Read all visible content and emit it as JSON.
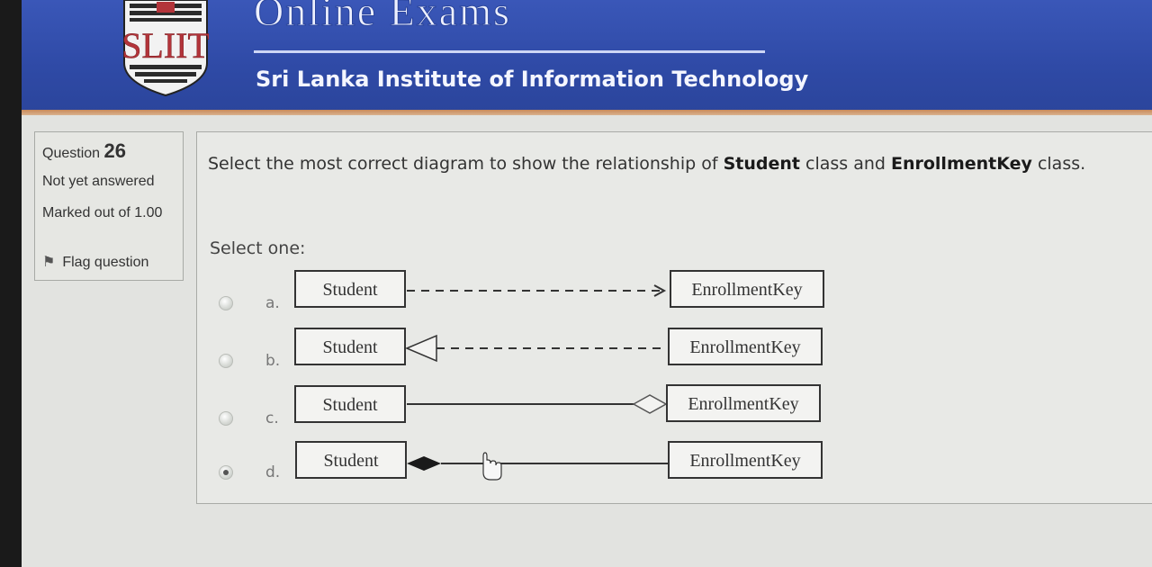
{
  "header": {
    "logo_text": "SLIIT",
    "site_title": "Online Exams",
    "institute": "Sri Lanka Institute of Information Technology"
  },
  "question_info": {
    "label": "Question",
    "number": "26",
    "state": "Not yet answered",
    "marked": "Marked out of 1.00",
    "flag_label": "Flag question"
  },
  "question": {
    "text_before": "Select the most correct diagram to show the relationship of ",
    "class_a": "Student",
    "text_middle": " class and ",
    "class_b": "EnrollmentKey",
    "text_after": " class.",
    "prompt": "Select one:",
    "options": [
      {
        "letter": "a.",
        "left_box": "Student",
        "right_box": "EnrollmentKey",
        "relation": "dependency",
        "selected": false
      },
      {
        "letter": "b.",
        "left_box": "Student",
        "right_box": "EnrollmentKey",
        "relation": "realization",
        "selected": false
      },
      {
        "letter": "c.",
        "left_box": "Student",
        "right_box": "EnrollmentKey",
        "relation": "aggregation",
        "selected": false
      },
      {
        "letter": "d.",
        "left_box": "Student",
        "right_box": "EnrollmentKey",
        "relation": "composition",
        "selected": true
      }
    ]
  },
  "colors": {
    "header_blue": "#2f4aa6",
    "accent_strip": "#c98a5a",
    "page_bg": "#e2e3e0"
  }
}
